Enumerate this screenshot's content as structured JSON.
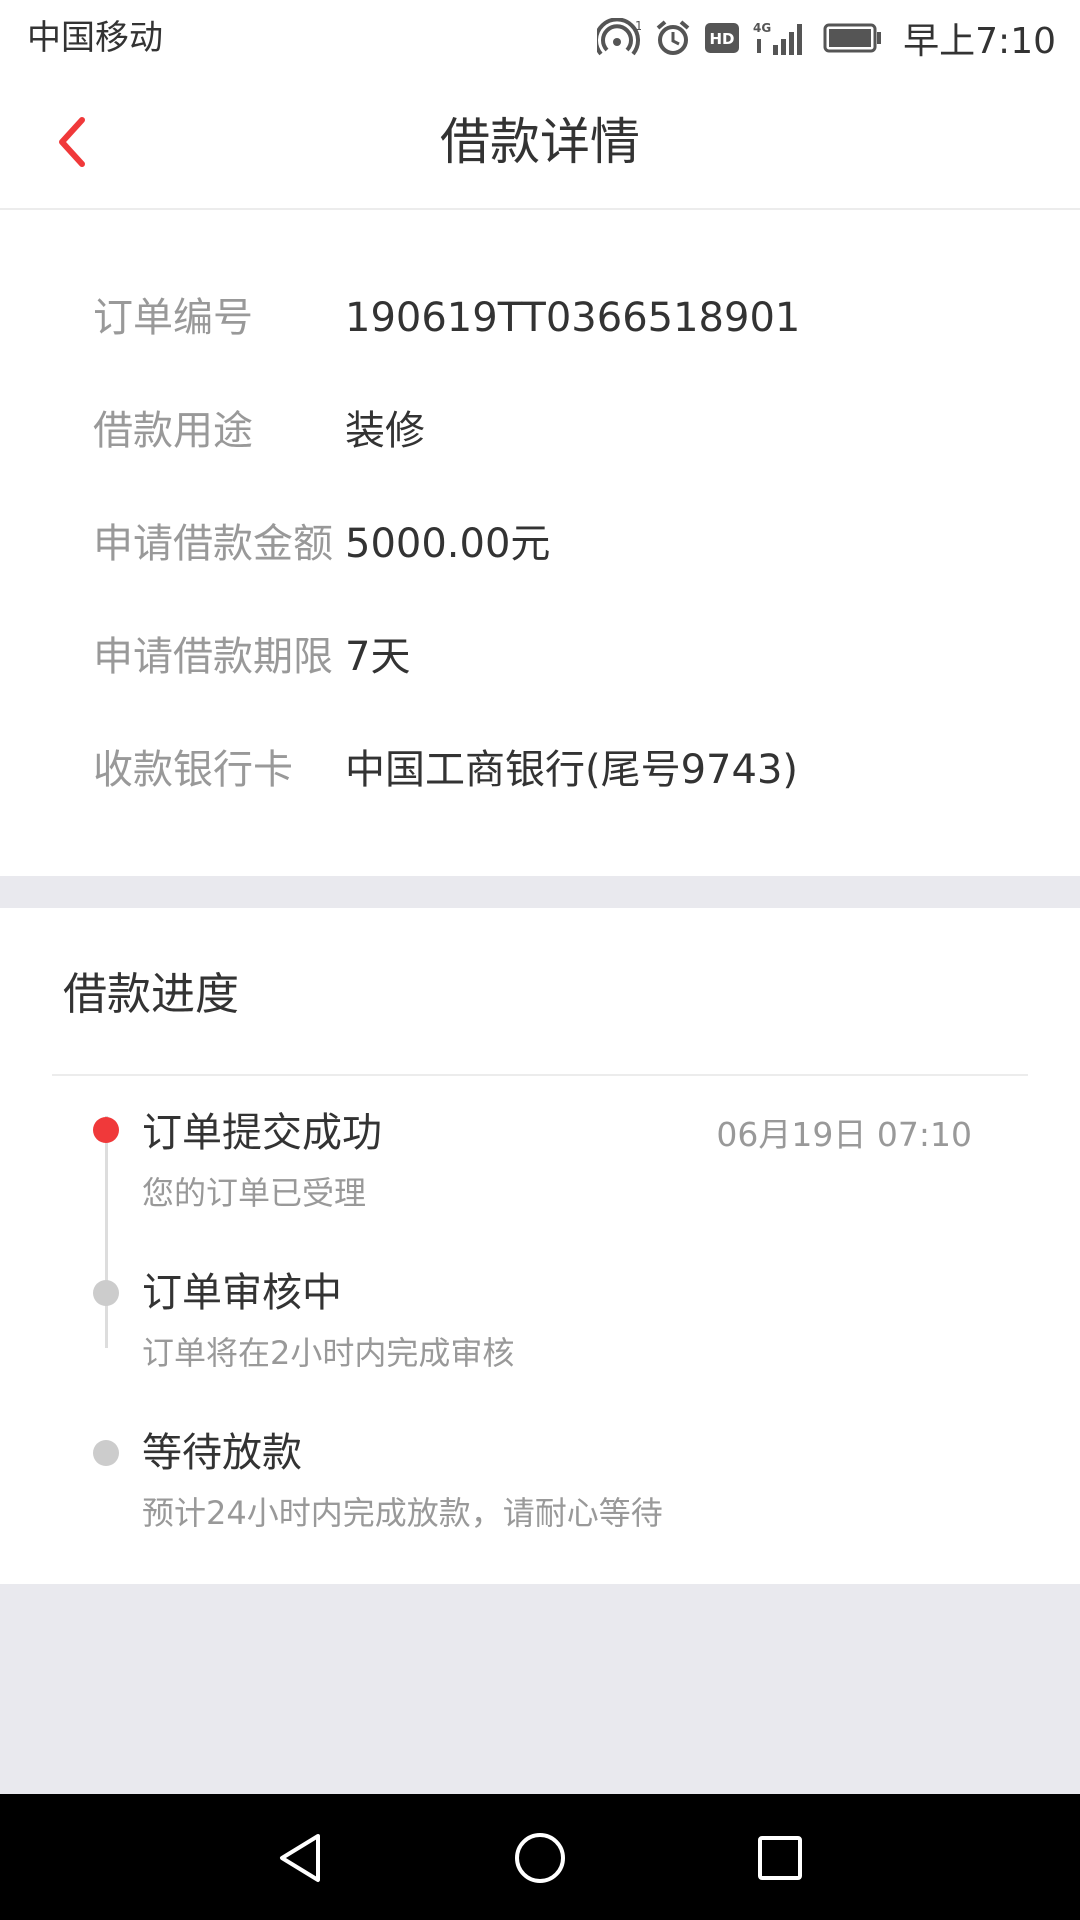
{
  "status_bar": {
    "carrier": "中国移动",
    "network": "4G",
    "time": "早上7:10"
  },
  "header": {
    "title": "借款详情"
  },
  "details": {
    "rows": [
      {
        "label": "订单编号",
        "value": "190619TT0366518901"
      },
      {
        "label": "借款用途",
        "value": "装修"
      },
      {
        "label": "申请借款金额",
        "value": "5000.00元"
      },
      {
        "label": "申请借款期限",
        "value": "7天"
      },
      {
        "label": "收款银行卡",
        "value": "中国工商银行(尾号9743)"
      }
    ]
  },
  "progress": {
    "title": "借款进度",
    "steps": [
      {
        "title": "订单提交成功",
        "desc": "您的订单已受理",
        "time": "06月19日 07:10",
        "active": true
      },
      {
        "title": "订单审核中",
        "desc": "订单将在2小时内完成审核",
        "active": false
      },
      {
        "title": "等待放款",
        "desc": "预计24小时内完成放款，请耐心等待",
        "active": false
      }
    ]
  },
  "colors": {
    "accent": "#f0393a",
    "inactive_dot": "#cccccc",
    "background": "#e9e9ee"
  },
  "icons": {
    "back": "chevron-left-icon",
    "nav_back": "triangle-back-icon",
    "nav_home": "circle-home-icon",
    "nav_recents": "square-recents-icon"
  }
}
